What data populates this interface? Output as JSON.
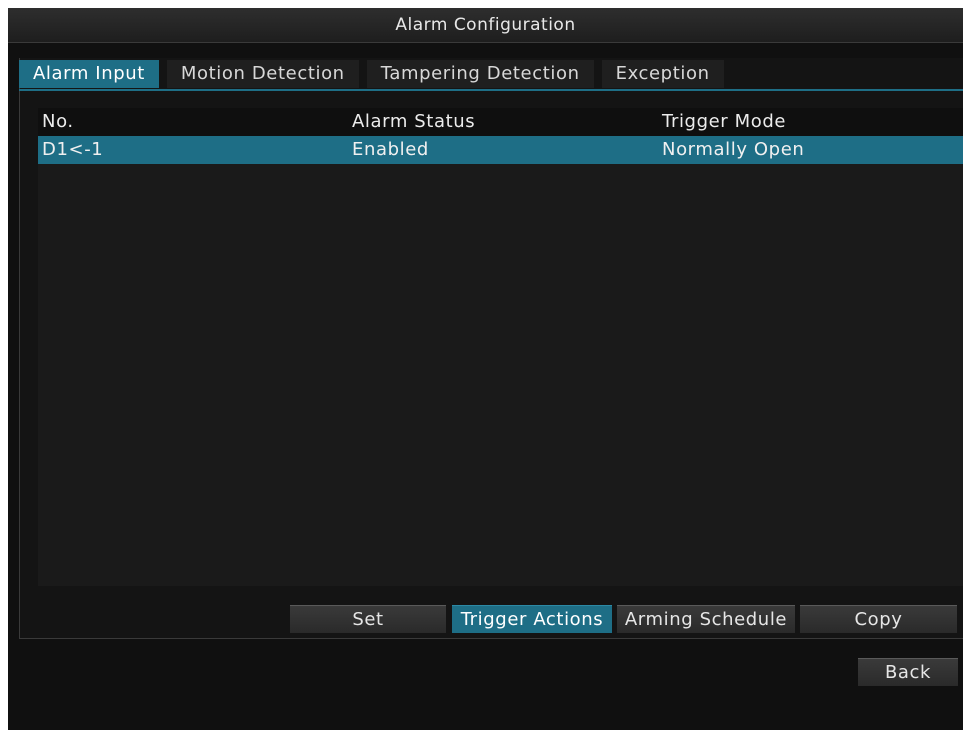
{
  "window": {
    "title": "Alarm Configuration"
  },
  "tabs": [
    {
      "label": "Alarm Input",
      "active": true
    },
    {
      "label": "Motion Detection",
      "active": false
    },
    {
      "label": "Tampering Detection",
      "active": false
    },
    {
      "label": "Exception",
      "active": false
    }
  ],
  "table": {
    "columns": [
      "No.",
      "Alarm Status",
      "Trigger Mode"
    ],
    "rows": [
      {
        "no": "D1<-1",
        "status": "Enabled",
        "mode": "Normally Open",
        "selected": true
      }
    ]
  },
  "actions": {
    "set": "Set",
    "trigger_actions": "Trigger Actions",
    "arming_schedule": "Arming Schedule",
    "copy": "Copy",
    "back": "Back"
  },
  "colors": {
    "accent": "#1e6e86",
    "background": "#101010",
    "text": "#e8e8e8"
  }
}
